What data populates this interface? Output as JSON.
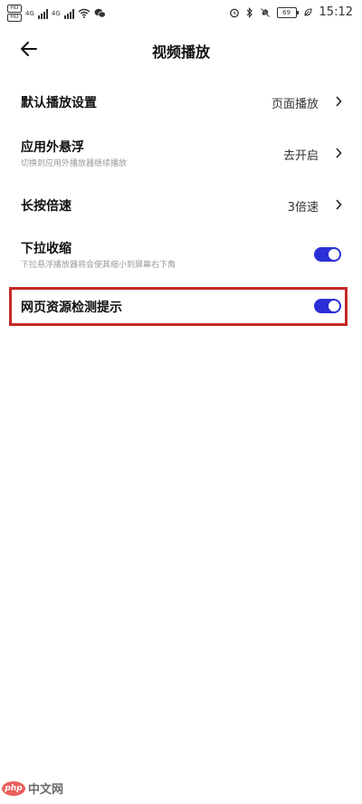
{
  "status_bar": {
    "sim1": "HD",
    "sim2": "HD",
    "net1": "4G",
    "net2": "4G",
    "battery": "69",
    "time": "15:12"
  },
  "header": {
    "title": "视频播放"
  },
  "settings": [
    {
      "label": "默认播放设置",
      "value": "页面播放",
      "type": "nav"
    },
    {
      "label": "应用外悬浮",
      "subtitle": "切换到应用外播放器继续播放",
      "value": "去开启",
      "type": "nav"
    },
    {
      "label": "长按倍速",
      "value": "3倍速",
      "type": "nav"
    },
    {
      "label": "下拉收缩",
      "subtitle": "下拉悬浮播放器将会使其缩小到屏幕右下角",
      "enabled": true,
      "type": "toggle"
    },
    {
      "label": "网页资源检测提示",
      "enabled": true,
      "type": "toggle"
    }
  ],
  "colors": {
    "accent": "#2b2fd6",
    "highlight": "#c62828"
  },
  "watermark": {
    "logo": "php",
    "text": "中文网"
  }
}
